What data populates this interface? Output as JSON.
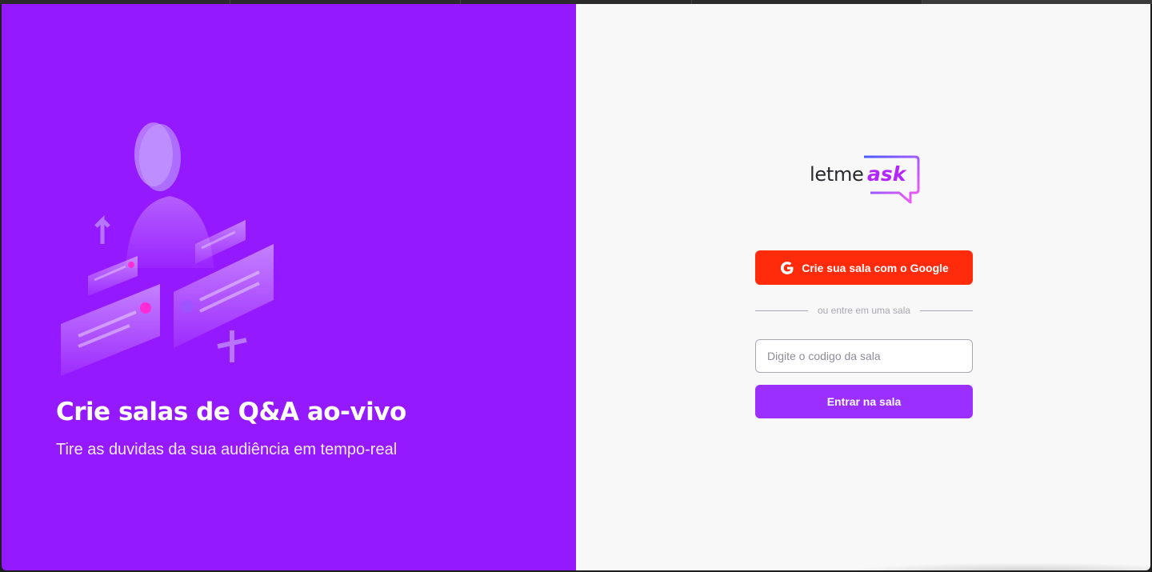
{
  "aside": {
    "title": "Crie salas de Q&A ao-vivo",
    "subtitle": "Tire as duvidas da sua audiência em tempo-real",
    "illustration_icon": "qa-illustration-icon"
  },
  "logo": {
    "part1": "letme",
    "part2": "ask"
  },
  "google_button": {
    "label": "Crie sua sala com o Google"
  },
  "separator": {
    "text": "ou entre em uma sala"
  },
  "room_input": {
    "placeholder": "Digite o codigo da sala",
    "value": ""
  },
  "enter_button": {
    "label": "Entrar na sala"
  },
  "colors": {
    "aside_bg": "#9519ff",
    "main_bg": "#f8f8f8",
    "google_btn": "#ff2b0a",
    "enter_btn": "#9b2fff",
    "logo_accent": "#b326ff"
  }
}
